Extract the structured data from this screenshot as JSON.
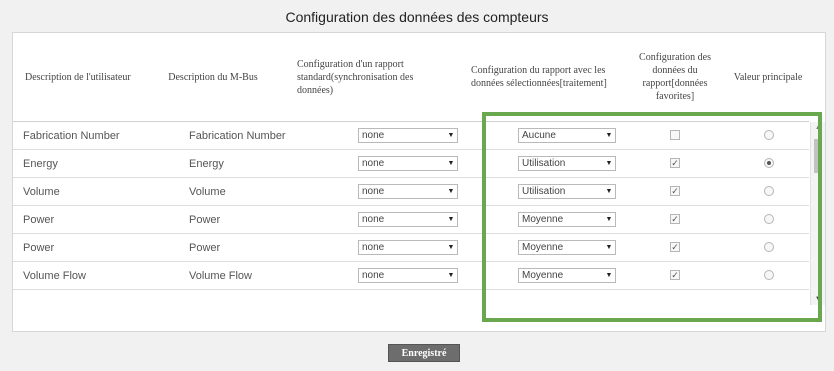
{
  "page": {
    "title": "Configuration des données des compteurs",
    "save_label": "Enregistré",
    "highlight_color": "#6aa84f"
  },
  "table": {
    "headers": [
      "Description de l'utilisateur",
      "Description du M-Bus",
      "Configuration d'un rapport standard(synchronisation des données)",
      "Configuration du rapport avec les données sélectionnées[traitement]",
      "Configuration des données du rapport[données favorites]",
      "Valeur principale"
    ],
    "rows": [
      {
        "user_desc": "Fabrication Number",
        "mbus_desc": "Fabrication Number",
        "standard": "none",
        "processing": "Aucune",
        "favorite": false,
        "main": false
      },
      {
        "user_desc": "Energy",
        "mbus_desc": "Energy",
        "standard": "none",
        "processing": "Utilisation",
        "favorite": true,
        "main": true
      },
      {
        "user_desc": "Volume",
        "mbus_desc": "Volume",
        "standard": "none",
        "processing": "Utilisation",
        "favorite": true,
        "main": false
      },
      {
        "user_desc": "Power",
        "mbus_desc": "Power",
        "standard": "none",
        "processing": "Moyenne",
        "favorite": true,
        "main": false
      },
      {
        "user_desc": "Power",
        "mbus_desc": "Power",
        "standard": "none",
        "processing": "Moyenne",
        "favorite": true,
        "main": false
      },
      {
        "user_desc": "Volume Flow",
        "mbus_desc": "Volume Flow",
        "standard": "none",
        "processing": "Moyenne",
        "favorite": true,
        "main": false
      }
    ]
  },
  "icons": {
    "dropdown": "chevron-down-icon",
    "checkbox_checked": "check-icon",
    "scroll_up": "scroll-up-icon",
    "scroll_down": "scroll-down-icon"
  }
}
